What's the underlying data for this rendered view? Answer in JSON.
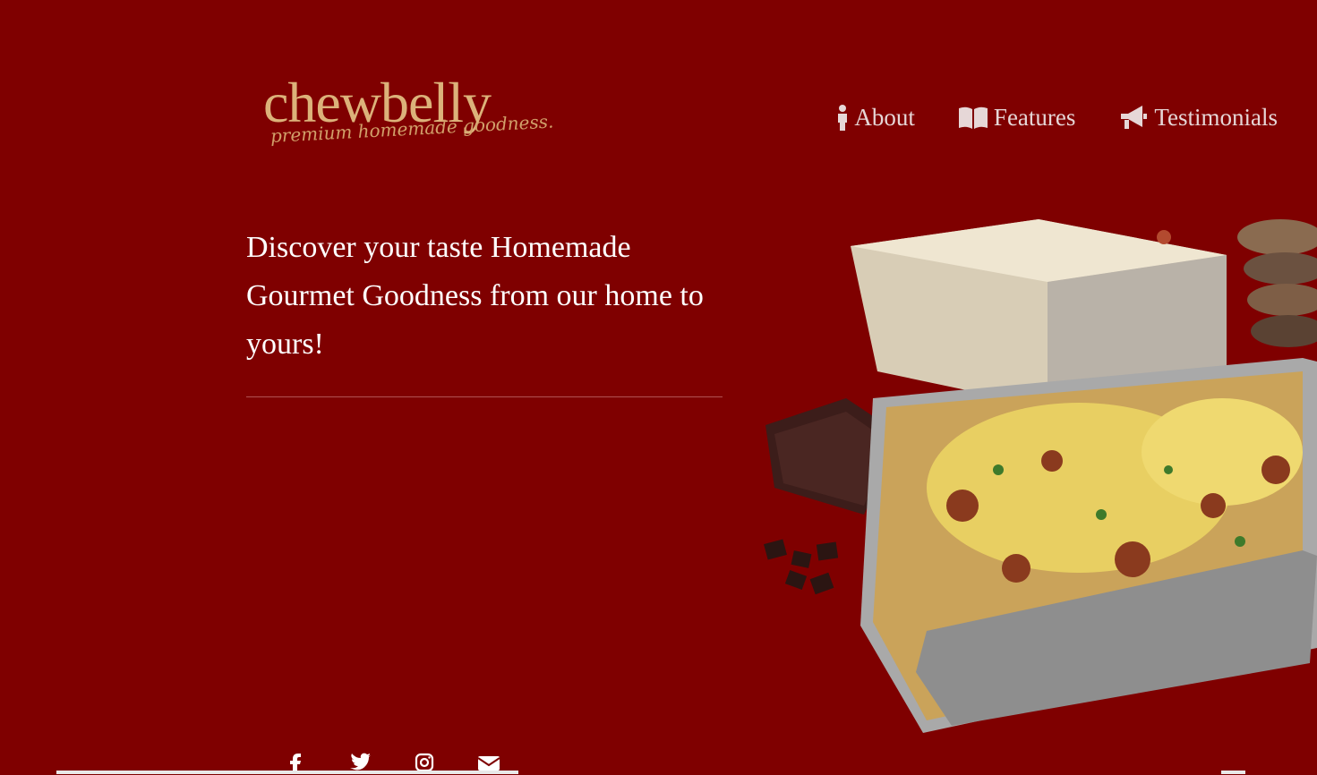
{
  "brand": {
    "name": "chewbelly",
    "tagline": "premium homemade goodness."
  },
  "nav": {
    "items": [
      {
        "label": "About",
        "icon": "person-icon"
      },
      {
        "label": "Features",
        "icon": "book-open-icon"
      },
      {
        "label": "Testimonials",
        "icon": "megaphone-icon"
      }
    ]
  },
  "hero": {
    "headline": "Discover your taste Homemade Gourmet Goodness from our home to yours!"
  },
  "social": {
    "icons": [
      "facebook-icon",
      "twitter-icon",
      "instagram-icon",
      "envelope-icon"
    ]
  },
  "colors": {
    "background": "#7f0000",
    "brand_gold": "#dcb27a",
    "nav_text": "#e6d7d7",
    "headline_text": "#ffffff"
  }
}
